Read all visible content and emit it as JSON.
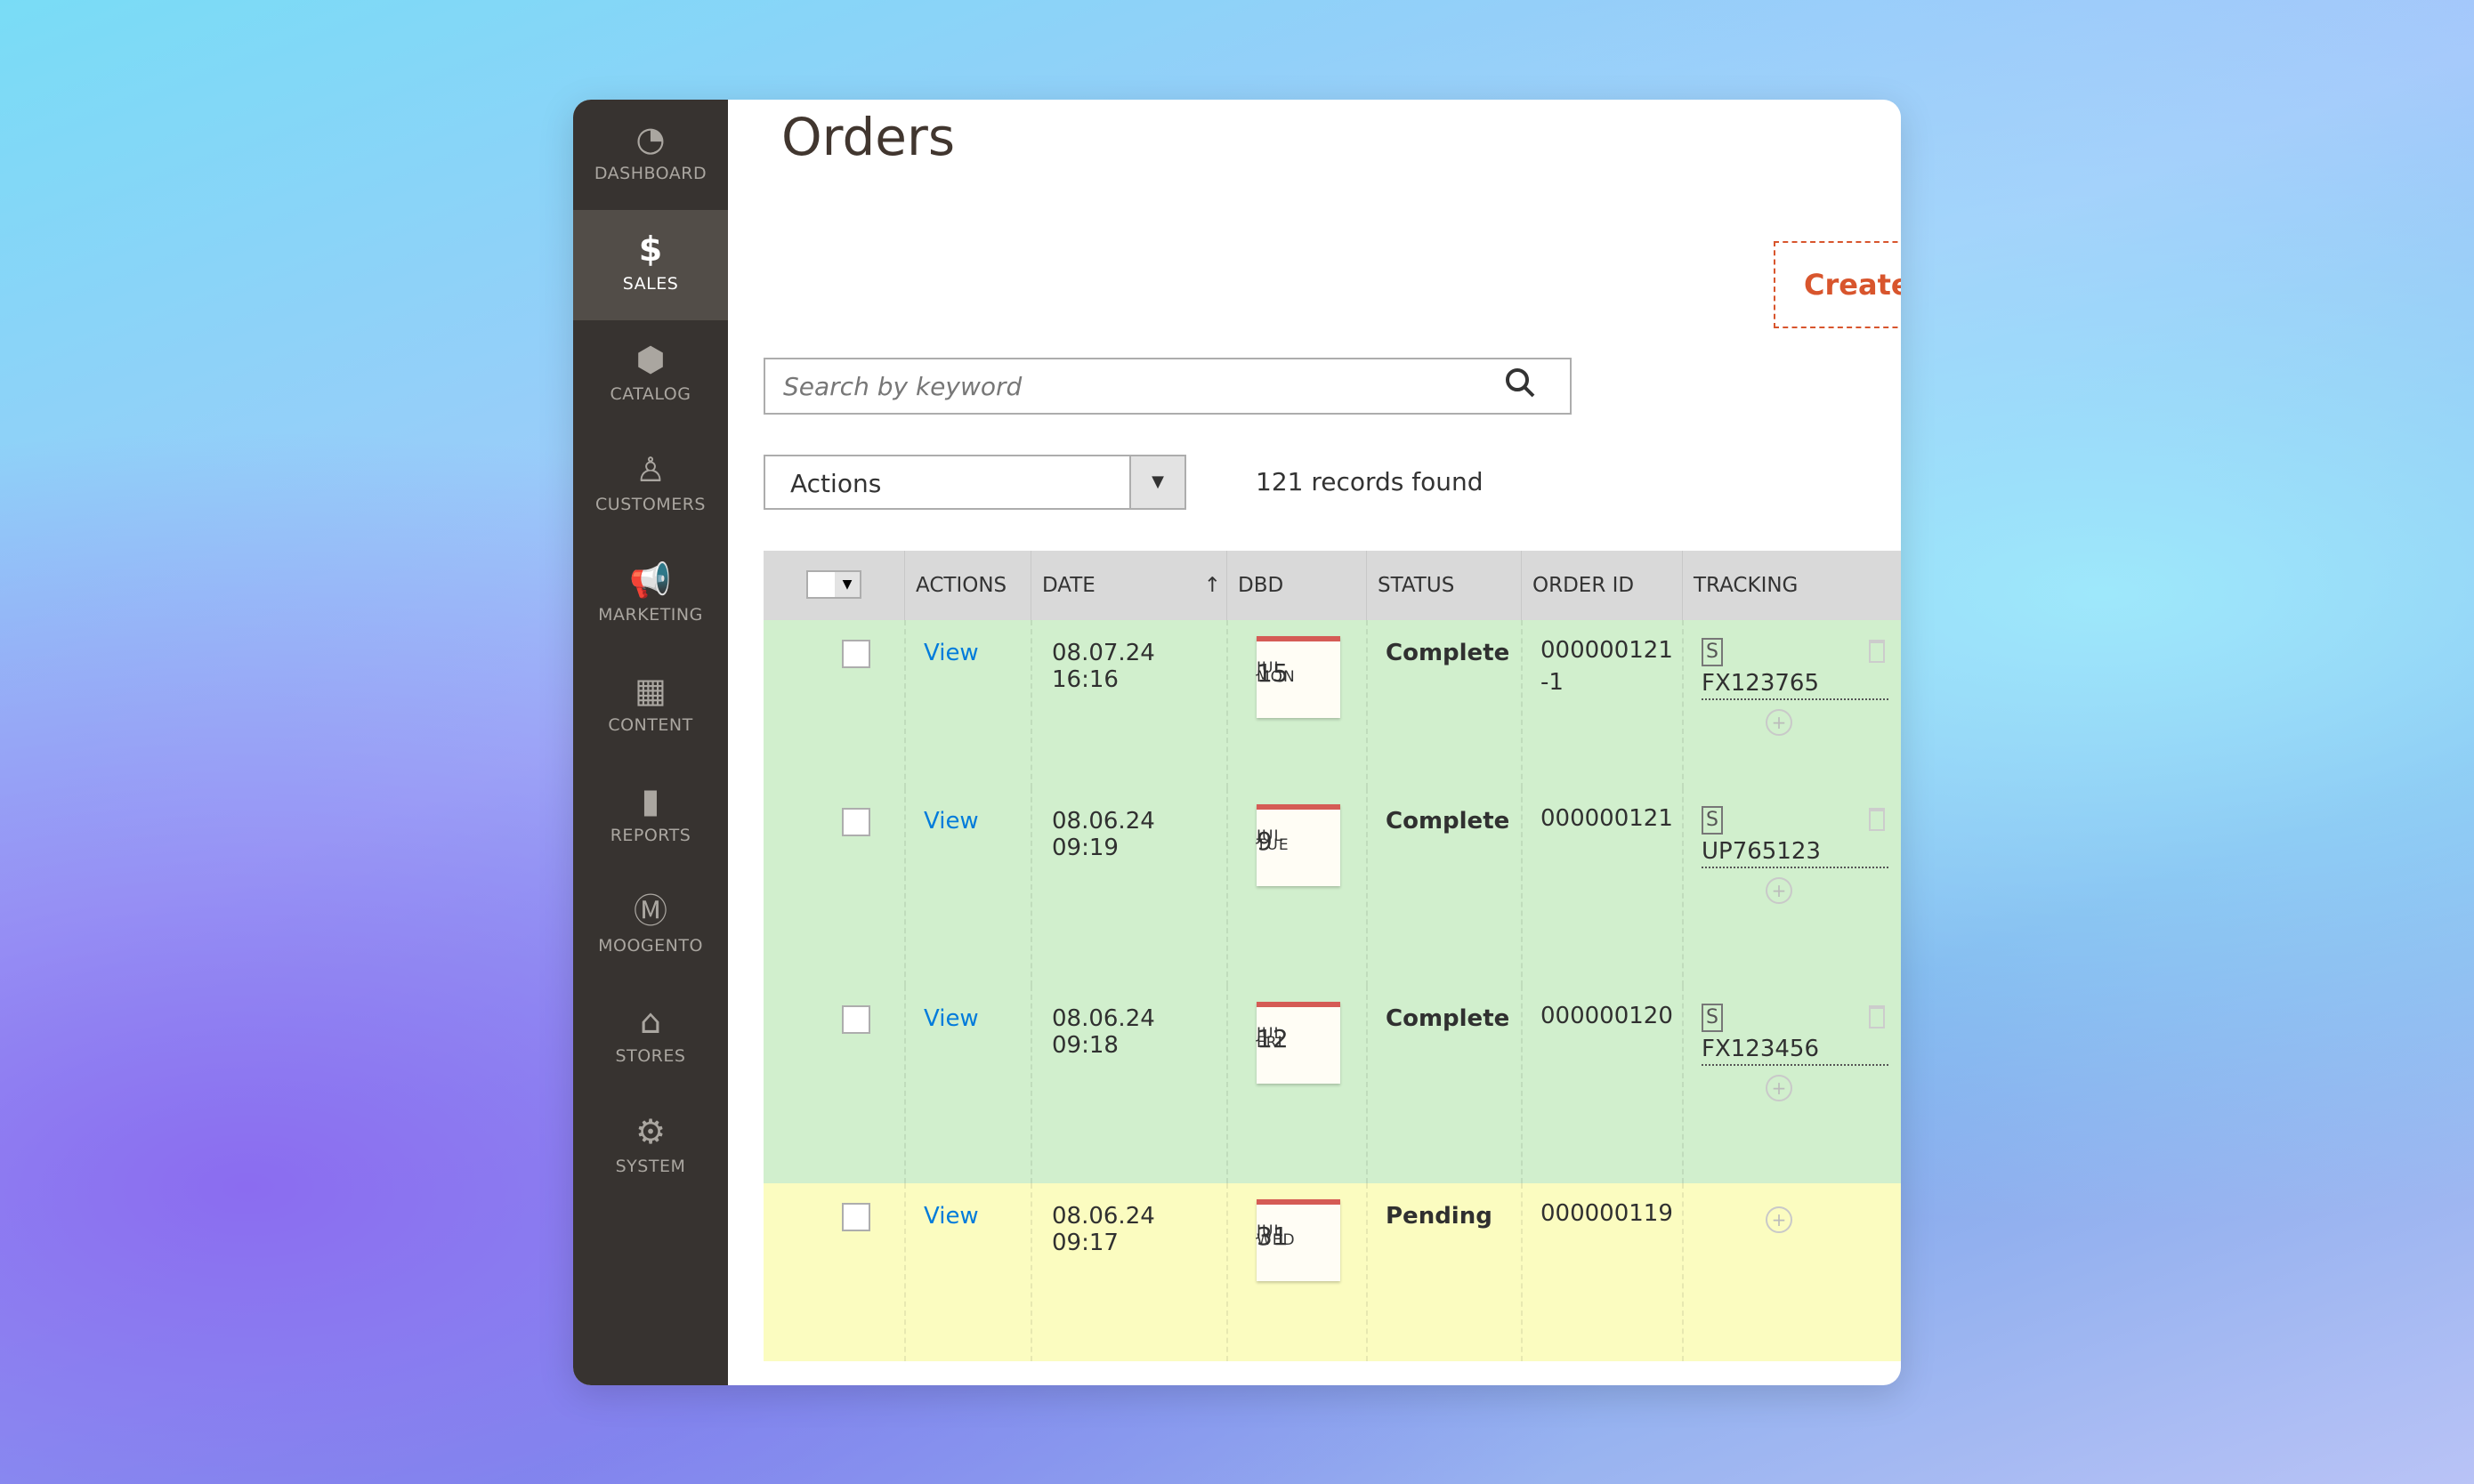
{
  "sidebar": {
    "items": [
      {
        "label": "DASHBOARD",
        "icon": "dashboard-icon",
        "active": false
      },
      {
        "label": "SALES",
        "icon": "dollar-icon",
        "active": true
      },
      {
        "label": "CATALOG",
        "icon": "box-icon",
        "active": false
      },
      {
        "label": "CUSTOMERS",
        "icon": "person-icon",
        "active": false
      },
      {
        "label": "MARKETING",
        "icon": "megaphone-icon",
        "active": false
      },
      {
        "label": "CONTENT",
        "icon": "layout-icon",
        "active": false
      },
      {
        "label": "REPORTS",
        "icon": "bar-chart-icon",
        "active": false
      },
      {
        "label": "MOOGENTO",
        "icon": "moogento-icon",
        "active": false
      },
      {
        "label": "STORES",
        "icon": "store-icon",
        "active": false
      },
      {
        "label": "SYSTEM",
        "icon": "gear-icon",
        "active": false
      }
    ]
  },
  "page": {
    "title": "Orders",
    "create_label": "Create"
  },
  "search": {
    "placeholder": "Search by keyword"
  },
  "toolbar": {
    "actions_label": "Actions",
    "records": "121 records found"
  },
  "table": {
    "headers": [
      "ACTIONS",
      "DATE",
      "DBD",
      "STATUS",
      "ORDER ID",
      "TRACKING"
    ],
    "sort_indicator": "↑",
    "rows": [
      {
        "action": "View",
        "date": "08.07.24 16:16",
        "dbd": {
          "day": "MON",
          "num": "15",
          "month": "JUL"
        },
        "status": "Complete",
        "order_id": "000000121-1",
        "carrier": "S",
        "tracking": "FX123765",
        "color": "#d1efcd"
      },
      {
        "action": "View",
        "date": "08.06.24 09:19",
        "dbd": {
          "day": "TUE",
          "num": "9",
          "month": "JUL"
        },
        "status": "Complete",
        "order_id": "000000121",
        "carrier": "S",
        "tracking": "UP765123",
        "color": "#d1efcd"
      },
      {
        "action": "View",
        "date": "08.06.24 09:18",
        "dbd": {
          "day": "FRI",
          "num": "12",
          "month": "JUL"
        },
        "status": "Complete",
        "order_id": "000000120",
        "carrier": "S",
        "tracking": "FX123456",
        "color": "#d1efcd"
      },
      {
        "action": "View",
        "date": "08.06.24 09:17",
        "dbd": {
          "day": "WED",
          "num": "31",
          "month": "JUL"
        },
        "status": "Pending",
        "order_id": "000000119",
        "carrier": "",
        "tracking": "",
        "color": "#fbfcc0"
      }
    ]
  }
}
